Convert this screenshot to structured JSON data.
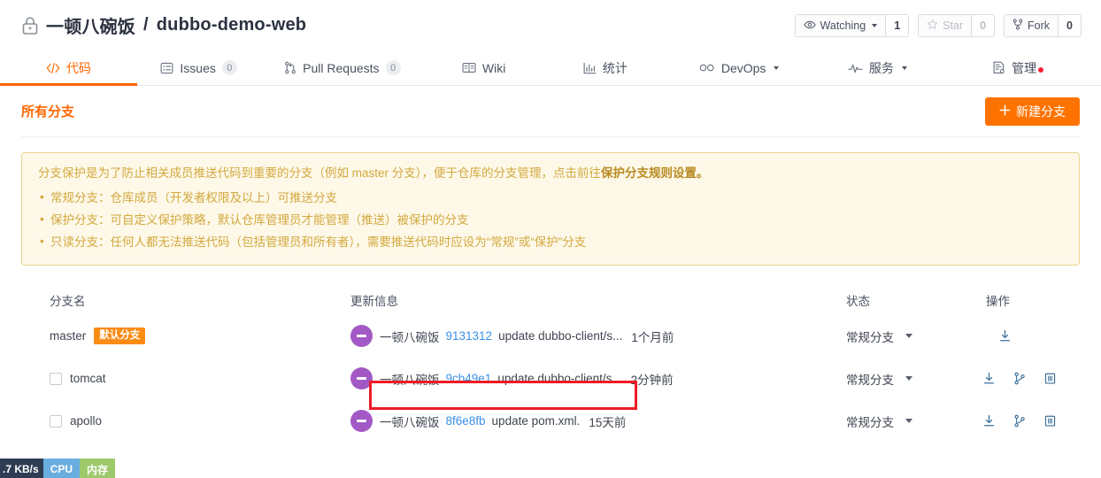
{
  "header": {
    "lock_icon": "lock-icon",
    "owner": "一顿八碗饭",
    "separator": "/",
    "repo": "dubbo-demo-web",
    "actions": {
      "watching_label": "Watching",
      "watching_count": "1",
      "star_label": "Star",
      "star_count": "0",
      "fork_label": "Fork",
      "fork_count": "0"
    }
  },
  "tabs": [
    {
      "label": "代码",
      "icon": "code-icon",
      "count": null,
      "active": true
    },
    {
      "label": "Issues",
      "icon": "issue-icon",
      "count": "0",
      "active": false
    },
    {
      "label": "Pull Requests",
      "icon": "pull-request-icon",
      "count": "0",
      "active": false
    },
    {
      "label": "Wiki",
      "icon": "wiki-icon",
      "count": null,
      "active": false
    },
    {
      "label": "统计",
      "icon": "chart-icon",
      "count": null,
      "active": false
    },
    {
      "label": "DevOps",
      "icon": "infinity-icon",
      "count": null,
      "active": false,
      "caret": true
    },
    {
      "label": "服务",
      "icon": "pulse-icon",
      "count": null,
      "active": false,
      "caret": true
    },
    {
      "label": "管理",
      "icon": "admin-icon",
      "count": null,
      "active": false,
      "dot": true
    }
  ],
  "section": {
    "title": "所有分支",
    "new_branch_button": "新建分支",
    "plus_icon": "plus-icon"
  },
  "notice": {
    "lead_prefix": "分支保护是为了防止相关成员推送代码到重要的分支（例如 master 分支），便于仓库的分支管理，点击前往",
    "lead_link": "保护分支规则设置。",
    "items": [
      "常规分支：仓库成员（开发者权限及以上）可推送分支",
      "保护分支：可自定义保护策略，默认仓库管理员才能管理（推送）被保护的分支",
      "只读分支：任何人都无法推送代码（包括管理员和所有者），需要推送代码时应设为“常规”或“保护”分支"
    ]
  },
  "table": {
    "columns": {
      "name": "分支名",
      "info": "更新信息",
      "status": "状态",
      "ops": "操作"
    },
    "rows": [
      {
        "checkbox": false,
        "has_checkbox": false,
        "name": "master",
        "badge": "默认分支",
        "avatar_icon": "avatar",
        "author": "一顿八碗饭",
        "sha": "9131312",
        "message": "update dubbo-client/s...",
        "time": "1个月前",
        "status": "常规分支",
        "ops": [
          "download-icon"
        ],
        "highlighted": false
      },
      {
        "checkbox": false,
        "has_checkbox": true,
        "name": "tomcat",
        "badge": null,
        "avatar_icon": "avatar",
        "author": "一顿八碗饭",
        "sha": "9cb49e1",
        "message": "update dubbo-client/s...",
        "time": "2分钟前",
        "status": "常规分支",
        "ops": [
          "download-icon",
          "merge-request-icon",
          "delete-icon"
        ],
        "highlighted": true
      },
      {
        "checkbox": false,
        "has_checkbox": true,
        "name": "apollo",
        "badge": null,
        "avatar_icon": "avatar",
        "author": "一顿八碗饭",
        "sha": "8f6e8fb",
        "message": "update pom.xml.",
        "time": "15天前",
        "status": "常规分支",
        "ops": [
          "download-icon",
          "merge-request-icon",
          "delete-icon"
        ],
        "highlighted": false
      }
    ]
  },
  "system_monitor": {
    "network": ".7 KB/s",
    "cpu": "CPU",
    "memory": "内存"
  },
  "colors": {
    "accent": "#f60",
    "primary_button": "#fe7300",
    "link": "#3a8ee6",
    "notice_bg": "#fdf8e8",
    "notice_border": "#e8d48a",
    "notice_text": "#d3a93f",
    "annotation": "#ee1c25",
    "avatar": "#a259c6",
    "badge": "#fa8c16"
  }
}
